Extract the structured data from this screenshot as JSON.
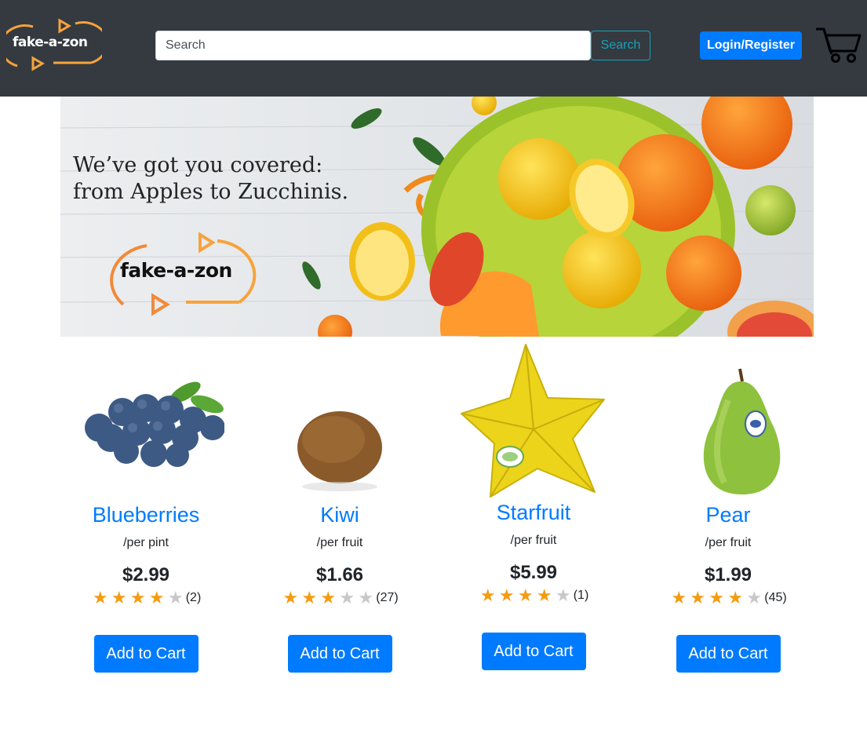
{
  "brand": {
    "logo_text": "fake-a-zon"
  },
  "search": {
    "placeholder": "Search",
    "button_label": "Search"
  },
  "nav": {
    "login_label": "Login/Register"
  },
  "banner": {
    "line1": "We’ve got you covered:",
    "line2": "from Apples to Zucchinis.",
    "logo_text": "fake-a-zon"
  },
  "colors": {
    "navbar": "#343a40",
    "primary": "#007bff",
    "info": "#17a2b8",
    "star": "#f39c12",
    "logo_orange": "#f7a33c"
  },
  "products": [
    {
      "name": "Blueberries",
      "unit": "/per pint",
      "price": "$2.99",
      "rating": 4,
      "reviews": "(2)",
      "cta": "Add to Cart",
      "icon": "blueberries-image"
    },
    {
      "name": "Kiwi",
      "unit": "/per fruit",
      "price": "$1.66",
      "rating": 3,
      "reviews": "(27)",
      "cta": "Add to Cart",
      "icon": "kiwi-image"
    },
    {
      "name": "Starfruit",
      "unit": "/per fruit",
      "price": "$5.99",
      "rating": 4,
      "reviews": "(1)",
      "cta": "Add to Cart",
      "icon": "starfruit-image"
    },
    {
      "name": "Pear",
      "unit": "/per fruit",
      "price": "$1.99",
      "rating": 4,
      "reviews": "(45)",
      "cta": "Add to Cart",
      "icon": "pear-image"
    }
  ]
}
